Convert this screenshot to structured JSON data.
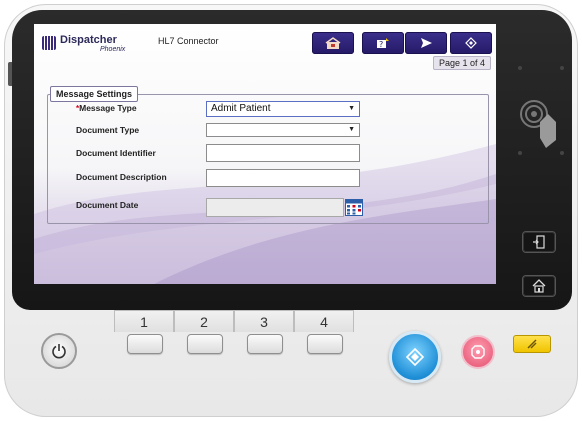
{
  "header": {
    "logo_name": "Dispatcher",
    "logo_sub": "Phoenix",
    "app_title": "HL7 Connector",
    "buttons": [
      {
        "icon": "home-folder-icon"
      },
      {
        "icon": "help-icon"
      },
      {
        "icon": "send-icon"
      },
      {
        "icon": "start-icon"
      }
    ],
    "page_indicator": "Page 1 of 4"
  },
  "form": {
    "section_title": "Message Settings",
    "required_mark": "*",
    "fields": [
      {
        "label": "Message Type",
        "value": "Admit Patient",
        "type": "select",
        "required": true
      },
      {
        "label": "Document Type",
        "value": "",
        "type": "select",
        "required": false
      },
      {
        "label": "Document Identifier",
        "value": "",
        "type": "text",
        "required": false
      },
      {
        "label": "Document Description",
        "value": "",
        "type": "text",
        "required": false
      },
      {
        "label": "Document Date",
        "value": "",
        "type": "date",
        "required": false
      }
    ]
  },
  "keypad": {
    "numbers": [
      "1",
      "2",
      "3",
      "4"
    ]
  },
  "colors": {
    "brand": "#2d2a5a",
    "header_button": "#2f2480",
    "start_button": "#1e8ed6",
    "stop_button": "#e3506f",
    "reset_button": "#f0c400"
  }
}
